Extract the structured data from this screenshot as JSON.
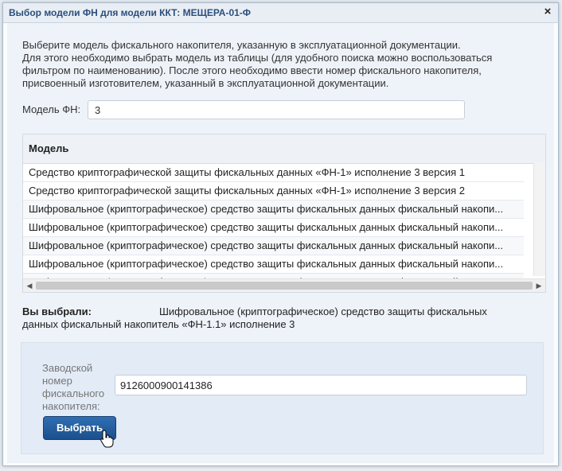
{
  "dialog": {
    "title": "Выбор модели ФН для модели ККТ: МЕЩЕРА-01-Ф",
    "close_glyph": "×"
  },
  "intro": {
    "line1": "Выберите модель фискального накопителя, указанную в эксплуатационной документации.",
    "line2": "Для этого необходимо выбрать модель из таблицы (для удобного поиска можно воспользоваться",
    "line3": "фильтром по наименованию). После этого необходимо ввести номер фискального накопителя,",
    "line4": "присвоенный изготовителем, указанный в эксплуатационной документации."
  },
  "filter": {
    "label": "Модель ФН:",
    "value": "3"
  },
  "table": {
    "header": "Модель",
    "rows": [
      "Средство криптографической защиты фискальных данных «ФН-1» исполнение 3 версия 1",
      "Средство криптографической защиты фискальных данных «ФН-1» исполнение 3 версия 2",
      "Шифровальное (криптографическое) средство защиты фискальных данных фискальный накопи...",
      "Шифровальное (криптографическое) средство защиты фискальных данных фискальный накопи...",
      "Шифровальное (криптографическое) средство защиты фискальных данных фискальный накопи...",
      "Шифровальное (криптографическое) средство защиты фискальных данных фискальный накопи...",
      "Шифровальное (криптографическое) средство защиты фискальных данных фискальный накопи..."
    ]
  },
  "selection": {
    "label": "Вы выбрали:",
    "value_line1": "Шифровальное (криптографическое) средство защиты фискальных",
    "value_line2": "данных фискальный накопитель «ФН-1.1» исполнение 3"
  },
  "serial": {
    "label": "Заводской номер фискального накопителя:",
    "value": "9126000900141386"
  },
  "actions": {
    "select_label": "Выбрать"
  },
  "colors": {
    "accent": "#1c4f8c",
    "title": "#2a4f7a"
  }
}
